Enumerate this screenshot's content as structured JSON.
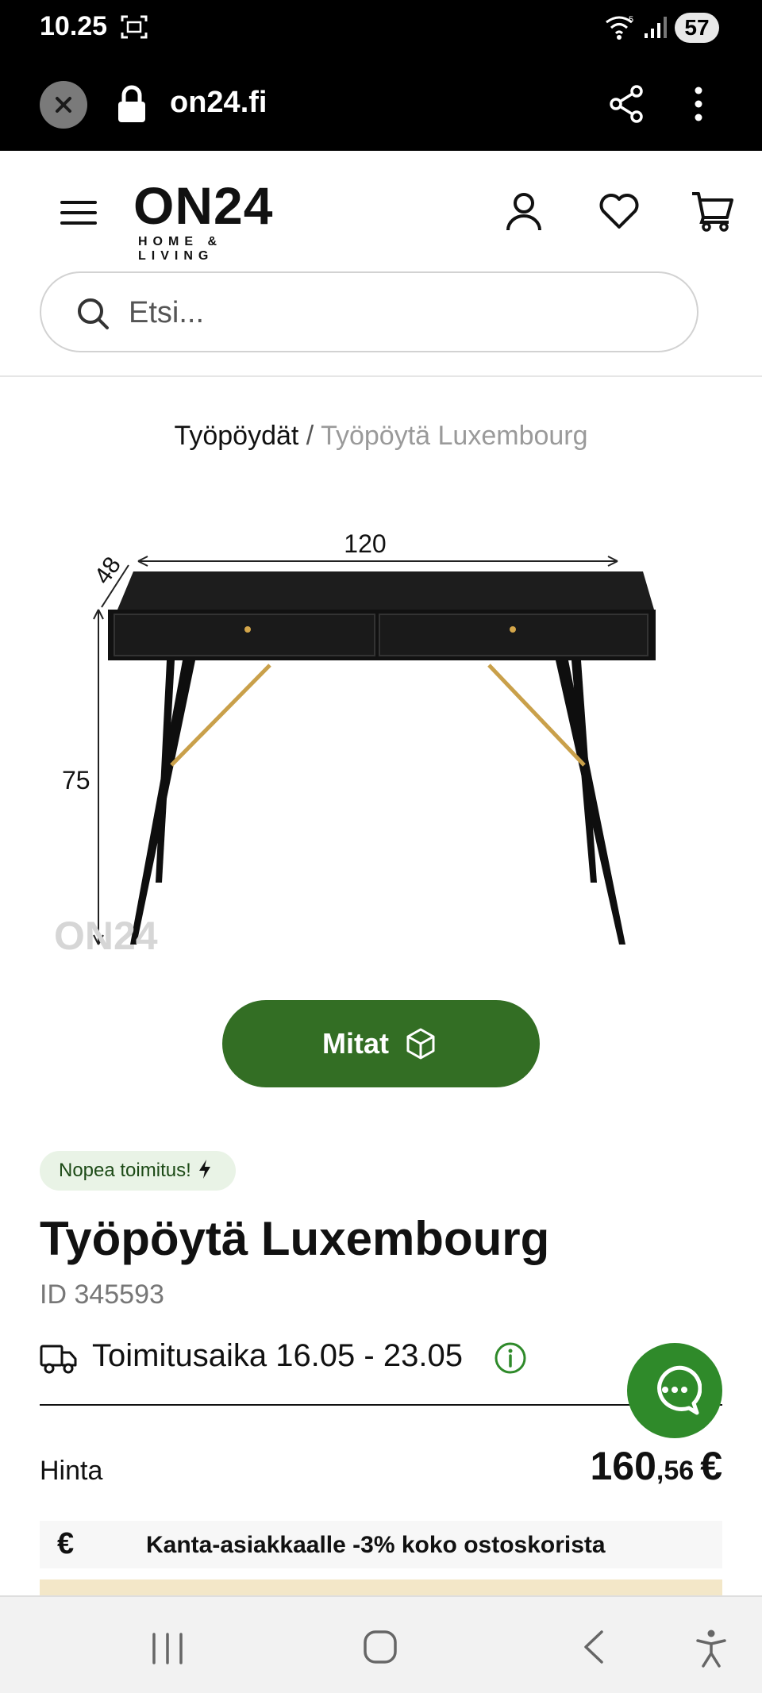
{
  "status_bar": {
    "time": "10.25",
    "battery": "57"
  },
  "browser": {
    "url": "on24.fi"
  },
  "header": {
    "logo_main": "ON24",
    "logo_sub": "HOME & LIVING",
    "search_placeholder": "Etsi..."
  },
  "breadcrumb": {
    "parent": "Työpöydät",
    "separator": "/",
    "current": "Työpöytä Luxembourg"
  },
  "product_image": {
    "width_label": "120",
    "depth_label": "48",
    "height_label": "75",
    "watermark": "ON24"
  },
  "dimensions_button": {
    "label": "Mitat"
  },
  "product": {
    "badge": "Nopea toimitus!",
    "title": "Työpöytä Luxembourg",
    "id": "ID 345593",
    "delivery": "Toimitusaika 16.05 - 23.05",
    "price_label": "Hinta",
    "price_int": "160",
    "price_cents": ",56",
    "price_currency": "€",
    "loyalty_symbol": "€",
    "loyalty_text": "Kanta-asiakkaalle -3% koko ostoskorista"
  },
  "colors": {
    "brand_green": "#336e24",
    "chat_green": "#2f8a2a"
  }
}
